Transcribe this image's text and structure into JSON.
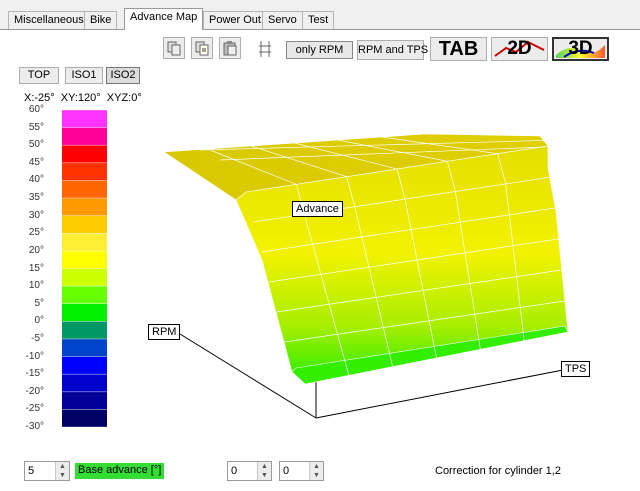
{
  "tabs": [
    {
      "label": "Miscellaneous",
      "active": false
    },
    {
      "label": "Bike",
      "active": false
    },
    {
      "label": "Advance Map",
      "active": true
    },
    {
      "label": "Power Out",
      "active": false
    },
    {
      "label": "Servo",
      "active": false
    },
    {
      "label": "Test",
      "active": false
    }
  ],
  "toolbar": {
    "icons": [
      "copy-icon",
      "copy-to-icon",
      "paste-icon",
      "align-icon"
    ],
    "only_rpm": "only RPM",
    "rpm_and_tps": "RPM and TPS",
    "tab": "TAB",
    "two_d": "2D",
    "three_d": "3D"
  },
  "views": {
    "top": "TOP",
    "iso1": "ISO1",
    "iso2": "ISO2",
    "selected": "ISO2"
  },
  "angles": "X:-25°  XY:120°  XYZ:0°",
  "legend": {
    "ticks": [
      "60°",
      "55°",
      "50°",
      "45°",
      "40°",
      "35°",
      "30°",
      "25°",
      "20°",
      "15°",
      "10°",
      "5°",
      "0°",
      "-5°",
      "-10°",
      "-15°",
      "-20°",
      "-25°",
      "-30°"
    ],
    "colors": [
      "#ff33ff",
      "#ff0099",
      "#ff0000",
      "#ff3300",
      "#ff6600",
      "#ff9900",
      "#ffcc00",
      "#ffee33",
      "#ffff00",
      "#ccff00",
      "#66ff00",
      "#00ee00",
      "#009966",
      "#0044cc",
      "#0000ff",
      "#0000cc",
      "#000099",
      "#000066"
    ]
  },
  "plot": {
    "axis_labels": {
      "advance": "Advance",
      "rpm": "RPM",
      "tps": "TPS"
    },
    "surface_colors": {
      "top": "#d4c400",
      "mid": "#f0f000",
      "low": "#44ee00"
    }
  },
  "bottom": {
    "step_value": "5",
    "base_advance_label": "Base advance [°]",
    "base_advance_bg": "#33dd33",
    "value1": "0",
    "value2": "0",
    "correction": "Correction for cylinder 1,2"
  }
}
